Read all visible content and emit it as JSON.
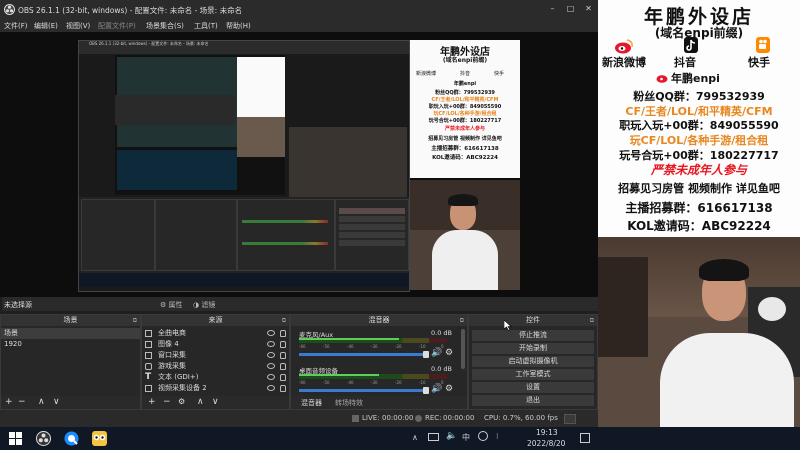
{
  "window": {
    "title": "OBS 26.1.1 (32-bit, windows) - 配置文件: 未命名 - 场景: 未命名",
    "menu": [
      "文件(F)",
      "编辑(E)",
      "视图(V)",
      "配置文件(P)",
      "场景集合(S)",
      "工具(T)",
      "帮助(H)"
    ]
  },
  "status_no_source": "未选择源",
  "dock_buttons": {
    "properties": "属性",
    "filters": "滤镜"
  },
  "scenes": {
    "header": "场景",
    "items": [
      {
        "label": "场景"
      },
      {
        "label": "1920"
      }
    ]
  },
  "sources": {
    "header": "来源",
    "items": [
      {
        "label": "全曲电商"
      },
      {
        "label": "图像 4"
      },
      {
        "label": "窗口采集"
      },
      {
        "label": "游戏采集"
      },
      {
        "label": "文本 (GDI+)"
      },
      {
        "label": "视频采集设备 2"
      }
    ]
  },
  "mixer": {
    "header": "混音器",
    "channels": [
      {
        "name": "麦克风/Aux",
        "db": "0.0 dB"
      },
      {
        "name": "桌面音频设备",
        "db": "0.0 dB"
      }
    ],
    "ticks": [
      "-60",
      "-50",
      "-40",
      "-30",
      "-20",
      "-10",
      "0"
    ],
    "tabs": [
      "混音器",
      "转场特效"
    ]
  },
  "controls": {
    "header": "控件",
    "buttons": [
      "停止推流",
      "开始录制",
      "启动虚拟摄像机",
      "工作室模式",
      "设置",
      "退出"
    ]
  },
  "statusbar": {
    "live_label": "LIVE:",
    "live_time": "00:00:00",
    "rec_label": "REC:",
    "rec_time": "00:00:00",
    "cpu": "CPU: 0.7%, 60.00 fps"
  },
  "taskbar": {
    "time": "19:13",
    "date": "2022/8/20"
  },
  "overlay": {
    "title": "年鹏外设店",
    "subtitle": "(域名enpi前缀)",
    "socials": [
      "新浪微博",
      "抖音",
      "快手"
    ],
    "handle": "年鹏enpi",
    "lines": [
      "粉丝QQ群：799532939",
      "CF/王者/LOL/和平精英/CFM",
      "职玩入玩+00群：849055590",
      "玩CF/LOL/各种手游/租合租",
      "玩号合玩+00群：180227717",
      "严禁未成年人参与",
      "招募见习房管 视频制作 详见鱼吧",
      "主播招募群：616617138",
      "KOL邀请码：ABC92224"
    ]
  },
  "colors": {
    "orange": "#e8871e",
    "red": "#e8171e",
    "obs_bg": "#1f1f1f",
    "taskbar": "#101826"
  },
  "mini_preview": {
    "meter_ticks": [
      "-60",
      "-40",
      "-20",
      "0"
    ]
  }
}
